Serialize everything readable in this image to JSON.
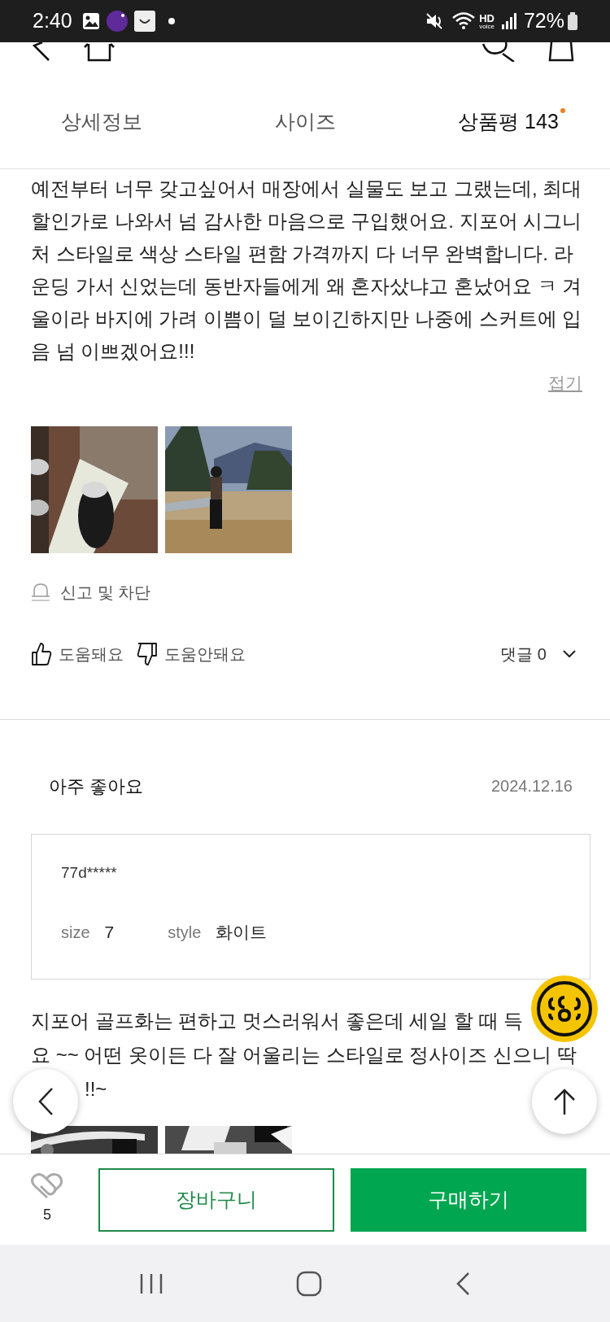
{
  "status_bar": {
    "time": "2:40",
    "hd_label": "HD",
    "hd_sub": "voice",
    "battery": "72%"
  },
  "tabs": [
    {
      "label": "상세정보",
      "selected": false,
      "dot": false
    },
    {
      "label": "사이즈",
      "selected": false,
      "dot": false
    },
    {
      "label": "상품평 143",
      "selected": true,
      "dot": true
    }
  ],
  "reviews": [
    {
      "text": "예전부터 너무 갖고싶어서 매장에서 실물도 보고 그랬는데, 최대\n할인가로 나와서 넘 감사한 마음으로 구입했어요. 지포어 시그니\n처 스타일로 색상 스타일 편함 가격까지 다 너무 완벽합니다. 라\n운딩 가서 신었는데 동반자들에게 왜 혼자샀냐고 혼났어요 ㅋ 겨\n울이라 바지에 가려 이쁨이 덜 보이긴하지만 나중에 스커트에 입\n음 넘 이쁘겠어요!!!",
      "collapse_label": "접기",
      "photos": [
        {
          "kind": "picture"
        },
        {
          "kind": "picture"
        }
      ],
      "report_label": "신고 및 차단",
      "helpful_label": "도움돼요",
      "unhelpful_label": "도움안돼요",
      "comments_label": "댓글 0"
    },
    {
      "title": "아주 좋아요",
      "date": "2024.12.16",
      "user": "77d*****",
      "options": [
        {
          "name": "size",
          "value": "7"
        },
        {
          "name": "style",
          "value": "화이트"
        }
      ],
      "text": "지포어 골프화는 편하고 멋스러워서 좋은데 세일 할 때 득\n요 ~~ 어떤 옷이든 다 잘 어울리는 스타일로 정사이즈 신으니 딱",
      "text_tail": "!!~",
      "photos": [
        {
          "kind": "picture"
        },
        {
          "kind": "picture"
        }
      ]
    }
  ],
  "bottom_bar": {
    "like_count": "5",
    "cart_label": "장바구니",
    "buy_label": "구매하기"
  }
}
